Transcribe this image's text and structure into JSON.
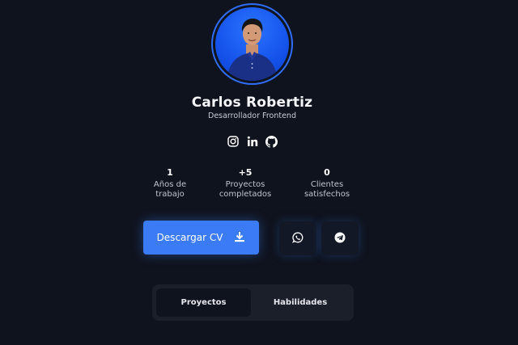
{
  "profile": {
    "name": "Carlos Robertiz",
    "role": "Desarrollador Frontend"
  },
  "socials": [
    {
      "icon": "instagram-icon"
    },
    {
      "icon": "linkedin-icon"
    },
    {
      "icon": "github-icon"
    }
  ],
  "stats": [
    {
      "value": "1",
      "label": "Años de\ntrabajo"
    },
    {
      "value": "+5",
      "label": "Proyectos\ncompletados"
    },
    {
      "value": "0",
      "label": "Clientes\nsatisfechos"
    }
  ],
  "actions": {
    "cv_label": "Descargar CV",
    "cv_icon": "download-icon",
    "whatsapp_icon": "whatsapp-icon",
    "telegram_icon": "telegram-icon"
  },
  "tabs": [
    {
      "label": "Proyectos",
      "active": true
    },
    {
      "label": "Habilidades",
      "active": false
    }
  ],
  "colors": {
    "background": "#0f131d",
    "accent": "#3b7cf6"
  }
}
